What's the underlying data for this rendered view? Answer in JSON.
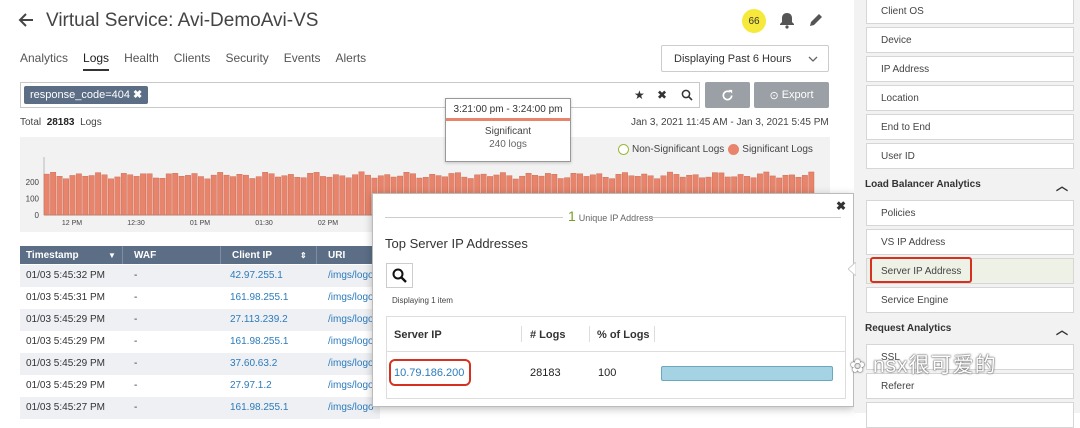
{
  "header": {
    "title": "Virtual Service:",
    "vs_name": "Avi-DemoAvi-VS",
    "badge": "66"
  },
  "tabs": [
    "Analytics",
    "Logs",
    "Health",
    "Clients",
    "Security",
    "Events",
    "Alerts"
  ],
  "active_tab": "Logs",
  "time_select": "Displaying Past 6 Hours",
  "filter": {
    "chip": "response_code=404"
  },
  "buttons": {
    "export": "Export"
  },
  "summary": {
    "total_label": "Total",
    "total_count": "28183",
    "logs_label": "Logs",
    "date_range": "Jan 3, 2021 11:45 AM - Jan 3, 2021 5:45 PM"
  },
  "histogram": {
    "y_ticks": [
      "200",
      "100",
      "0"
    ],
    "x_ticks": [
      "12 PM",
      "12:30",
      "01 PM",
      "01:30",
      "02 PM"
    ],
    "legend": {
      "non_significant": "Non-Significant Logs",
      "significant": "Significant Logs"
    },
    "tooltip": {
      "time": "3:21:00 pm - 3:24:00 pm",
      "label": "Significant",
      "count": "240",
      "unit": "logs"
    }
  },
  "log_table": {
    "headers": [
      "Timestamp",
      "WAF",
      "Client IP",
      "URI"
    ],
    "rows": [
      {
        "ts": "01/03 5:45:32 PM",
        "waf": "-",
        "ip": "42.97.255.1",
        "uri": "/imgs/logo"
      },
      {
        "ts": "01/03 5:45:31 PM",
        "waf": "-",
        "ip": "161.98.255.1",
        "uri": "/imgs/logo"
      },
      {
        "ts": "01/03 5:45:29 PM",
        "waf": "-",
        "ip": "27.113.239.2",
        "uri": "/imgs/logo"
      },
      {
        "ts": "01/03 5:45:29 PM",
        "waf": "-",
        "ip": "161.98.255.1",
        "uri": "/imgs/logo"
      },
      {
        "ts": "01/03 5:45:29 PM",
        "waf": "-",
        "ip": "37.60.63.2",
        "uri": "/imgs/logo"
      },
      {
        "ts": "01/03 5:45:29 PM",
        "waf": "-",
        "ip": "27.97.1.2",
        "uri": "/imgs/logo"
      },
      {
        "ts": "01/03 5:45:27 PM",
        "waf": "-",
        "ip": "161.98.255.1",
        "uri": "/imgs/logo"
      }
    ]
  },
  "popup": {
    "unique_count": "1",
    "unique_label": "Unique IP Address",
    "title": "Top Server IP Addresses",
    "displaying": "Displaying 1 item",
    "headers": {
      "ip": "Server IP",
      "logs": "# Logs",
      "pct": "% of Logs"
    },
    "row": {
      "ip": "10.79.186.200",
      "logs": "28183",
      "pct": "100"
    }
  },
  "sidebar": {
    "items_top": [
      "Client OS",
      "Device",
      "IP Address",
      "Location",
      "End to End",
      "User ID"
    ],
    "lb_section": "Load Balancer Analytics",
    "items_lb": [
      "Policies",
      "VS IP Address",
      "Server IP Address",
      "Service Engine"
    ],
    "req_section": "Request Analytics",
    "items_req": [
      "SSL",
      "Referer"
    ]
  },
  "watermark": "nsx很可爱的",
  "colors": {
    "accent": "#5b6e85",
    "significant": "#e8846b",
    "link": "#2b7bbd",
    "highlight": "#d7301f",
    "badge": "#f6e93b"
  }
}
